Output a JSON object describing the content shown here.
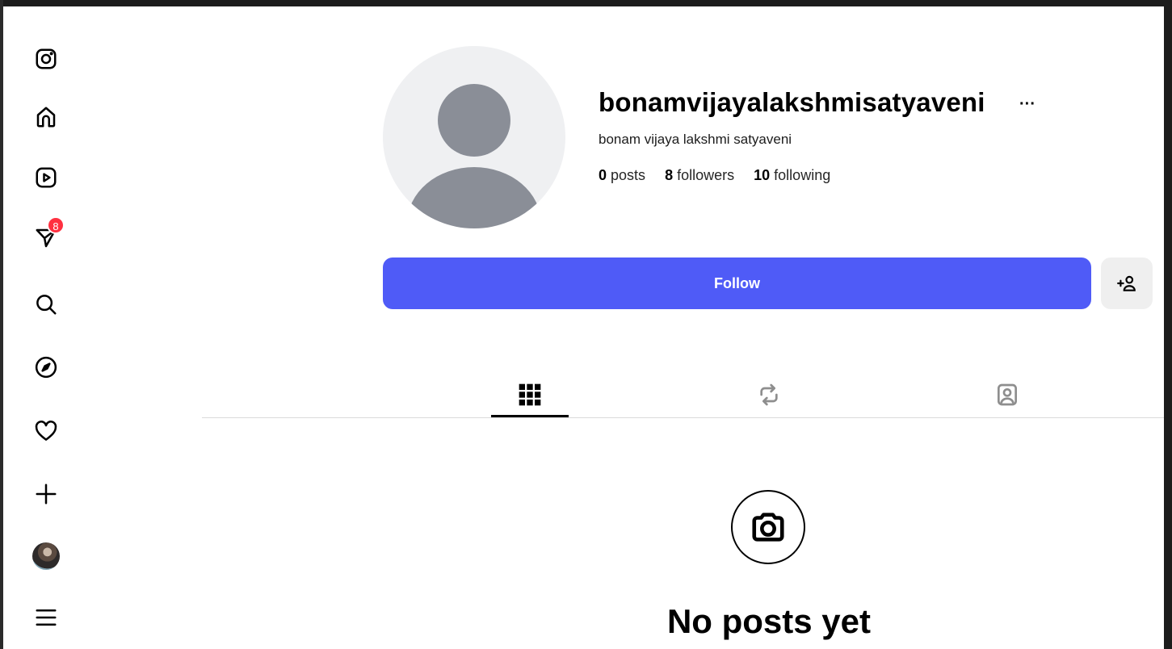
{
  "sidebar": {
    "items": [
      {
        "name": "instagram-logo-icon"
      },
      {
        "name": "home-icon"
      },
      {
        "name": "reels-icon"
      },
      {
        "name": "messages-icon",
        "badge": "8"
      },
      {
        "name": "search-icon"
      },
      {
        "name": "explore-icon"
      },
      {
        "name": "notifications-heart-icon"
      },
      {
        "name": "create-plus-icon"
      },
      {
        "name": "profile-avatar"
      },
      {
        "name": "more-menu-icon"
      }
    ]
  },
  "profile": {
    "username": "bonamvijayalakshmisatyaveni",
    "more_label": "···",
    "full_name": "bonam vijaya lakshmi satyaveni",
    "stats": {
      "posts_count": "0",
      "posts_label": "posts",
      "followers_count": "8",
      "followers_label": "followers",
      "following_count": "10",
      "following_label": "following"
    }
  },
  "actions": {
    "follow_label": "Follow",
    "suggest_icon": "add-person-icon"
  },
  "tabs": [
    {
      "name": "posts-grid-icon",
      "active": true
    },
    {
      "name": "reposts-icon",
      "active": false
    },
    {
      "name": "tagged-icon",
      "active": false
    }
  ],
  "empty_state": {
    "icon": "camera-icon",
    "title": "No posts yet"
  },
  "colors": {
    "follow_button": "#4f5bf7",
    "badge": "#ff3040"
  }
}
